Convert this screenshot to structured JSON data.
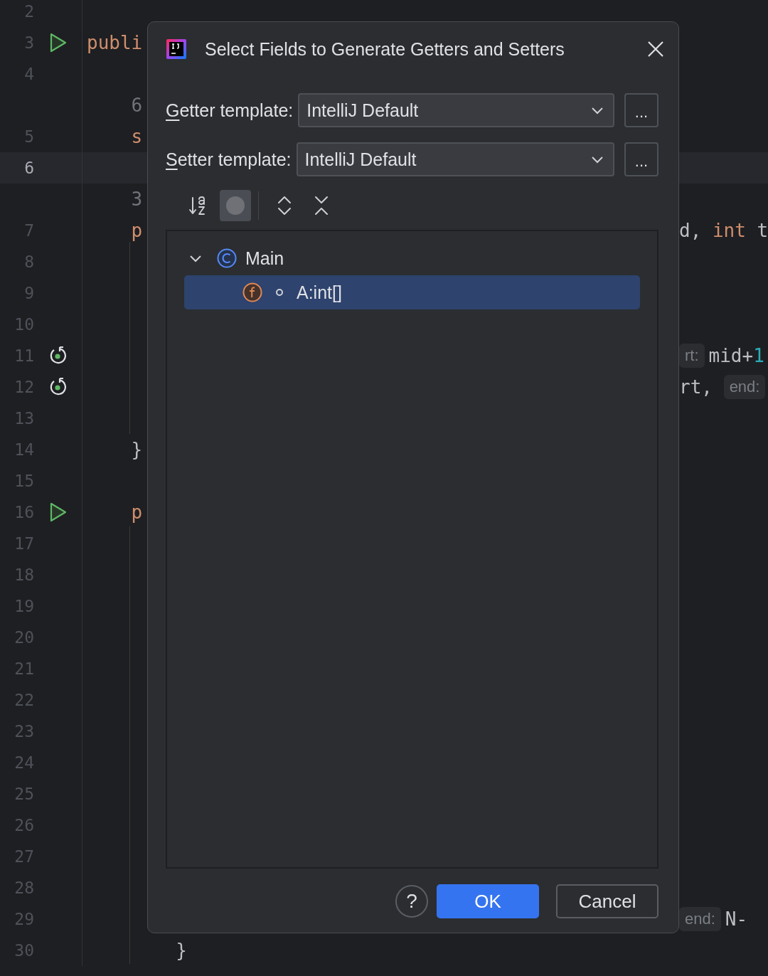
{
  "editor": {
    "rows": [
      {
        "kind": "line",
        "number": "2",
        "current": false
      },
      {
        "kind": "line",
        "number": "3",
        "current": false,
        "gutter": {
          "kind": "run"
        },
        "code": [
          {
            "kind": "keyword",
            "text": "publi"
          }
        ]
      },
      {
        "kind": "line",
        "number": "4",
        "current": false
      },
      {
        "kind": "inlay",
        "code": [
          {
            "kind": "usage",
            "text": "    6"
          }
        ]
      },
      {
        "kind": "line",
        "number": "5",
        "current": false,
        "code": [
          {
            "kind": "keyword",
            "text": "    s"
          }
        ]
      },
      {
        "kind": "line",
        "number": "6",
        "current": true
      },
      {
        "kind": "inlay",
        "code": [
          {
            "kind": "usage",
            "text": "    3"
          }
        ]
      },
      {
        "kind": "line",
        "number": "7",
        "current": false,
        "code": [
          {
            "kind": "keyword",
            "text": "    p"
          }
        ],
        "tail": [
          {
            "kind": "plain",
            "text": "d, "
          },
          {
            "kind": "keyword",
            "text": "int"
          },
          {
            "kind": "plain",
            "text": " t"
          }
        ]
      },
      {
        "kind": "line",
        "number": "8",
        "current": false
      },
      {
        "kind": "line",
        "number": "9",
        "current": false
      },
      {
        "kind": "line",
        "number": "10",
        "current": false
      },
      {
        "kind": "line",
        "number": "11",
        "current": false,
        "gutter": {
          "kind": "recursion"
        },
        "tail": [
          {
            "kind": "hint",
            "text": "rt:"
          },
          {
            "kind": "plain",
            "text": "mid+"
          },
          {
            "kind": "number",
            "text": "1"
          }
        ]
      },
      {
        "kind": "line",
        "number": "12",
        "current": false,
        "gutter": {
          "kind": "recursion"
        },
        "tail": [
          {
            "kind": "plain",
            "text": "rt, "
          },
          {
            "kind": "hint",
            "text": "end:"
          }
        ]
      },
      {
        "kind": "line",
        "number": "13",
        "current": false
      },
      {
        "kind": "line",
        "number": "14",
        "current": false,
        "code": [
          {
            "kind": "plain",
            "text": "    }"
          }
        ]
      },
      {
        "kind": "line",
        "number": "15",
        "current": false
      },
      {
        "kind": "line",
        "number": "16",
        "current": false,
        "gutter": {
          "kind": "run"
        },
        "code": [
          {
            "kind": "keyword",
            "text": "    p"
          }
        ]
      },
      {
        "kind": "line",
        "number": "17",
        "current": false
      },
      {
        "kind": "line",
        "number": "18",
        "current": false
      },
      {
        "kind": "line",
        "number": "19",
        "current": false
      },
      {
        "kind": "line",
        "number": "20",
        "current": false
      },
      {
        "kind": "line",
        "number": "21",
        "current": false
      },
      {
        "kind": "line",
        "number": "22",
        "current": false
      },
      {
        "kind": "line",
        "number": "23",
        "current": false
      },
      {
        "kind": "line",
        "number": "24",
        "current": false
      },
      {
        "kind": "line",
        "number": "25",
        "current": false
      },
      {
        "kind": "line",
        "number": "26",
        "current": false
      },
      {
        "kind": "line",
        "number": "27",
        "current": false
      },
      {
        "kind": "line",
        "number": "28",
        "current": false
      },
      {
        "kind": "line",
        "number": "29",
        "current": false,
        "tail": [
          {
            "kind": "hint",
            "text": "end:"
          },
          {
            "kind": "plain",
            "text": "N-"
          }
        ]
      },
      {
        "kind": "line",
        "number": "30",
        "current": false,
        "code": [
          {
            "kind": "plain",
            "text": "        }"
          }
        ]
      }
    ]
  },
  "dialog": {
    "title": "Select Fields to Generate Getters and Setters",
    "templates": [
      {
        "label": "Getter template:",
        "mnemonic": true,
        "value": "IntelliJ Default",
        "browse": "..."
      },
      {
        "label": "Setter template:",
        "mnemonic": true,
        "value": "IntelliJ Default",
        "browse": "..."
      }
    ],
    "toolbar": [
      [
        {
          "kind": "sort",
          "selected": false
        },
        {
          "kind": "circle",
          "selected": true
        }
      ],
      [
        {
          "kind": "expand",
          "selected": false
        },
        {
          "kind": "collapse",
          "selected": false
        }
      ]
    ],
    "tree": [
      {
        "kind": "class",
        "label": "Main",
        "expanded": true,
        "selected": false,
        "children": [
          {
            "kind": "field",
            "label": "A:int[]",
            "selected": true
          }
        ]
      }
    ],
    "help": "?",
    "buttons": [
      {
        "kind": "primary",
        "label": "OK"
      },
      {
        "kind": "secondary",
        "label": "Cancel"
      }
    ]
  }
}
